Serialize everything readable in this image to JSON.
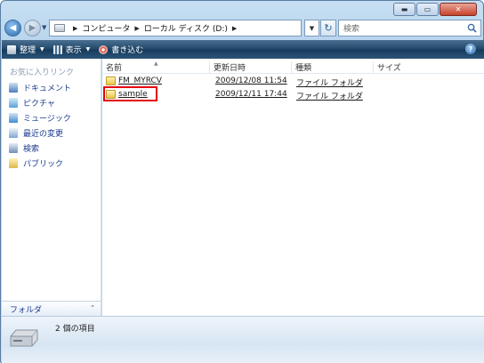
{
  "window": {
    "caption_minimize": "▬",
    "caption_maximize": "▭",
    "caption_close": "✕"
  },
  "nav": {
    "back_glyph": "◀",
    "forward_glyph": "▶"
  },
  "address": {
    "crumbs": [
      "コンピュータ",
      "ローカル ディスク (D:)"
    ],
    "refresh_glyph": "↻"
  },
  "search": {
    "placeholder": "検索"
  },
  "toolbar": {
    "organize": "整理",
    "views": "表示",
    "burn": "書き込む",
    "help_glyph": "?"
  },
  "navpane": {
    "title": "お気に入りリンク",
    "items": [
      {
        "label": "ドキュメント",
        "icon": "documents-icon",
        "color": "#4a7dc0"
      },
      {
        "label": "ピクチャ",
        "icon": "pictures-icon",
        "color": "#5aa0d8"
      },
      {
        "label": "ミュージック",
        "icon": "music-icon",
        "color": "#3f8ccf"
      },
      {
        "label": "最近の変更",
        "icon": "recent-changes-icon",
        "color": "#7ea6cf"
      },
      {
        "label": "検索",
        "icon": "search-folder-icon",
        "color": "#6e8fb6"
      },
      {
        "label": "パブリック",
        "icon": "public-folder-icon",
        "color": "#e0b84a"
      }
    ],
    "folders_label": "フォルダ"
  },
  "filelist": {
    "columns": [
      "名前",
      "更新日時",
      "種類",
      "サイズ"
    ],
    "rows": [
      {
        "name": "FM_MYRCV",
        "modified": "2009/12/08 11:54",
        "type": "ファイル フォルダ",
        "size": ""
      },
      {
        "name": "sample",
        "modified": "2009/12/11 17:44",
        "type": "ファイル フォルダ",
        "size": ""
      }
    ]
  },
  "details": {
    "item_count": "2 個の項目"
  },
  "colors": {
    "toolbar": "#1f4668",
    "highlight": "#e3000f",
    "link": "#1b3b8f"
  }
}
